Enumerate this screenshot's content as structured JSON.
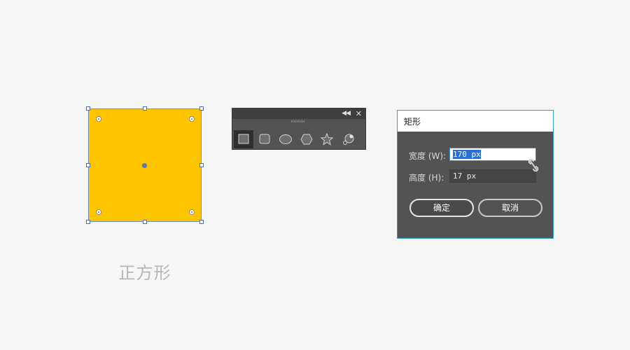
{
  "canvas": {
    "shape_fill": "#ffc400",
    "selection_color": "#4a6fb3",
    "caption": "正方形"
  },
  "tool_panel": {
    "collapse_icon": "double-chevron-left-icon",
    "close_icon": "close-icon",
    "tools": [
      {
        "name": "rectangle-tool",
        "icon": "rectangle-icon",
        "active": true
      },
      {
        "name": "rounded-rectangle-tool",
        "icon": "rounded-rectangle-icon",
        "active": false
      },
      {
        "name": "ellipse-tool",
        "icon": "ellipse-icon",
        "active": false
      },
      {
        "name": "polygon-tool",
        "icon": "hexagon-icon",
        "active": false
      },
      {
        "name": "star-tool",
        "icon": "star-icon",
        "active": false
      },
      {
        "name": "flare-tool",
        "icon": "flare-icon",
        "active": false
      }
    ]
  },
  "dialog": {
    "title": "矩形",
    "width_label": "宽度 (W):",
    "width_value": "170 px",
    "height_label": "高度 (H):",
    "height_value": "17 px",
    "constrain_icon": "broken-link-icon",
    "ok_label": "确定",
    "cancel_label": "取消",
    "accent_color": "#35a3c6"
  }
}
